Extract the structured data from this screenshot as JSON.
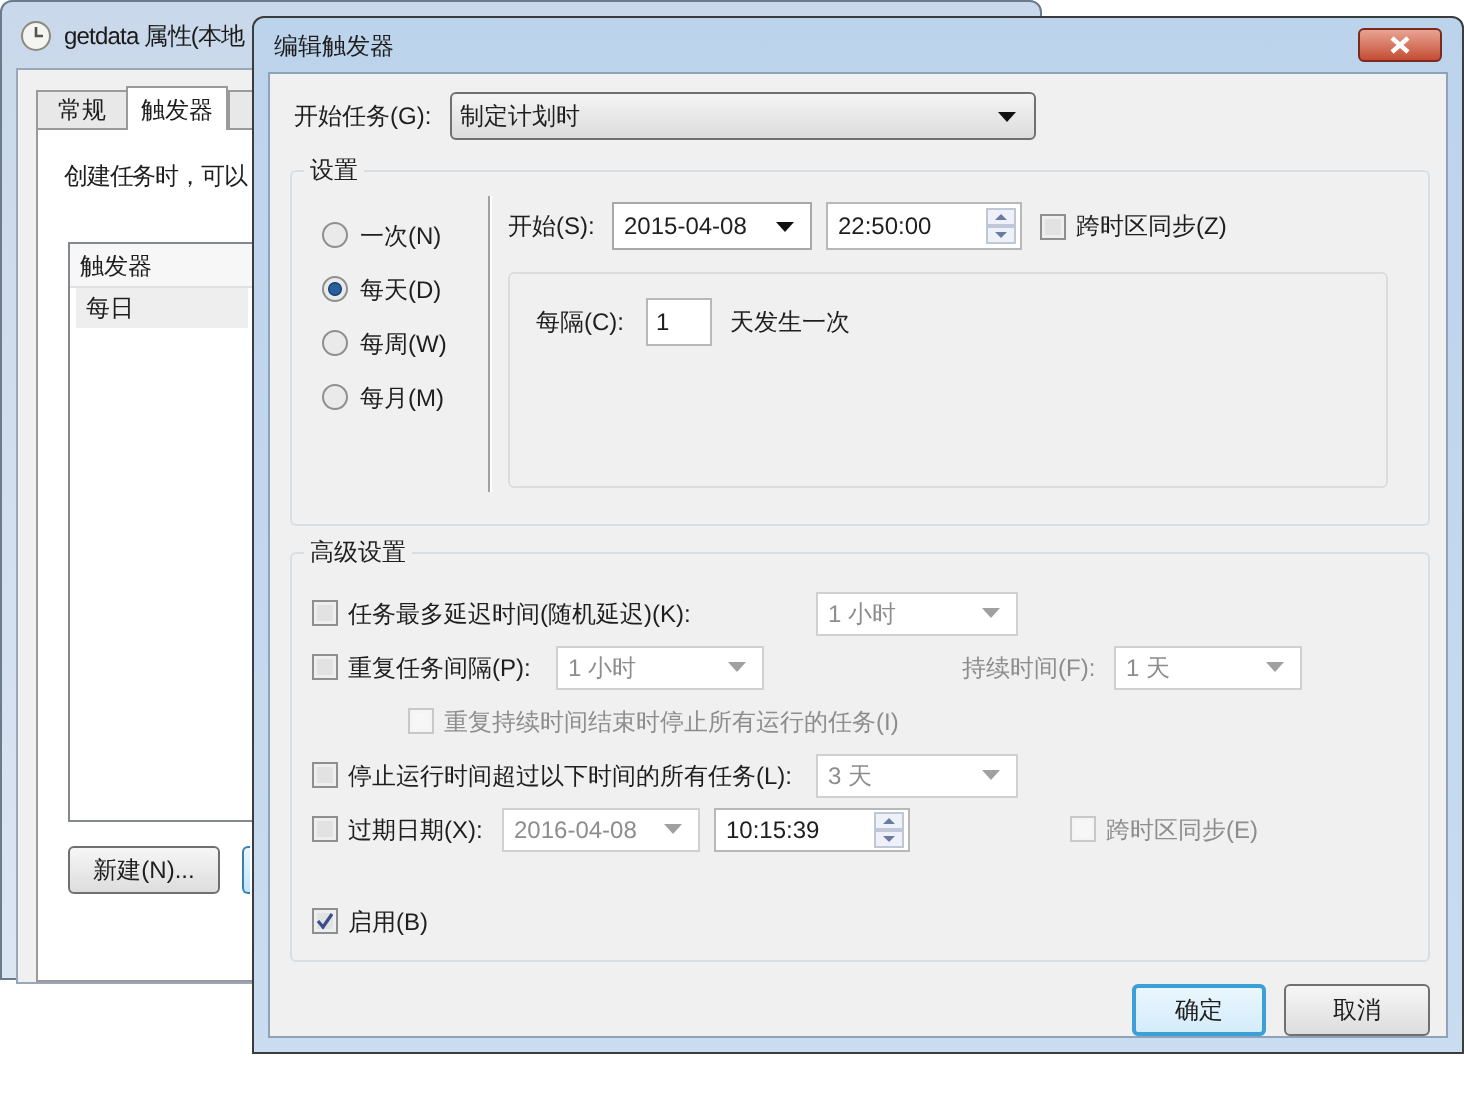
{
  "background_window": {
    "title": "getdata 属性(本地",
    "tabs": [
      {
        "label": "常规",
        "selected": false
      },
      {
        "label": "触发器",
        "selected": true
      }
    ],
    "description": "创建任务时，可以",
    "trigger_list": {
      "columns": [
        "触发器"
      ],
      "rows": [
        [
          "每日"
        ]
      ]
    },
    "buttons": [
      "新建(N)..."
    ]
  },
  "dialog": {
    "title": "编辑触发器",
    "begin_task": {
      "label": "开始任务(G):",
      "value": "制定计划时"
    },
    "settings": {
      "title": "设置",
      "options": [
        {
          "label": "一次(N)",
          "selected": false
        },
        {
          "label": "每天(D)",
          "selected": true
        },
        {
          "label": "每周(W)",
          "selected": false
        },
        {
          "label": "每月(M)",
          "selected": false
        }
      ],
      "start": {
        "label": "开始(S):",
        "date": "2015-04-08",
        "time": "22:50:00",
        "sync": {
          "label": "跨时区同步(Z)",
          "checked": false,
          "disabled": false
        }
      },
      "recur": {
        "label": "每隔(C):",
        "value": "1",
        "suffix": "天发生一次"
      }
    },
    "advanced": {
      "title": "高级设置",
      "delay": {
        "label": "任务最多延迟时间(随机延迟)(K):",
        "checked": false,
        "combo": {
          "value": "1 小时",
          "disabled": true
        }
      },
      "repeat": {
        "label": "重复任务间隔(P):",
        "checked": false,
        "combo": {
          "value": "1 小时",
          "disabled": true
        },
        "duration": {
          "label": "持续时间(F):",
          "value": "1 天",
          "disabled": true
        }
      },
      "stop_at_end": {
        "label": "重复持续时间结束时停止所有运行的任务(I)",
        "checked": false,
        "disabled": true
      },
      "stop_if_longer": {
        "label": "停止运行时间超过以下时间的所有任务(L):",
        "checked": false,
        "combo": {
          "value": "3 天",
          "disabled": true
        }
      },
      "expire": {
        "label": "过期日期(X):",
        "checked": false,
        "date": {
          "value": "2016-04-08",
          "disabled": true
        },
        "time": {
          "value": "10:15:39",
          "disabled": false
        },
        "sync": {
          "label": "跨时区同步(E)",
          "checked": false,
          "disabled": true
        }
      },
      "enabled": {
        "label": "启用(B)",
        "checked": true
      }
    },
    "buttons": [
      {
        "label": "确定",
        "default": true
      },
      {
        "label": "取消",
        "default": false
      }
    ]
  }
}
